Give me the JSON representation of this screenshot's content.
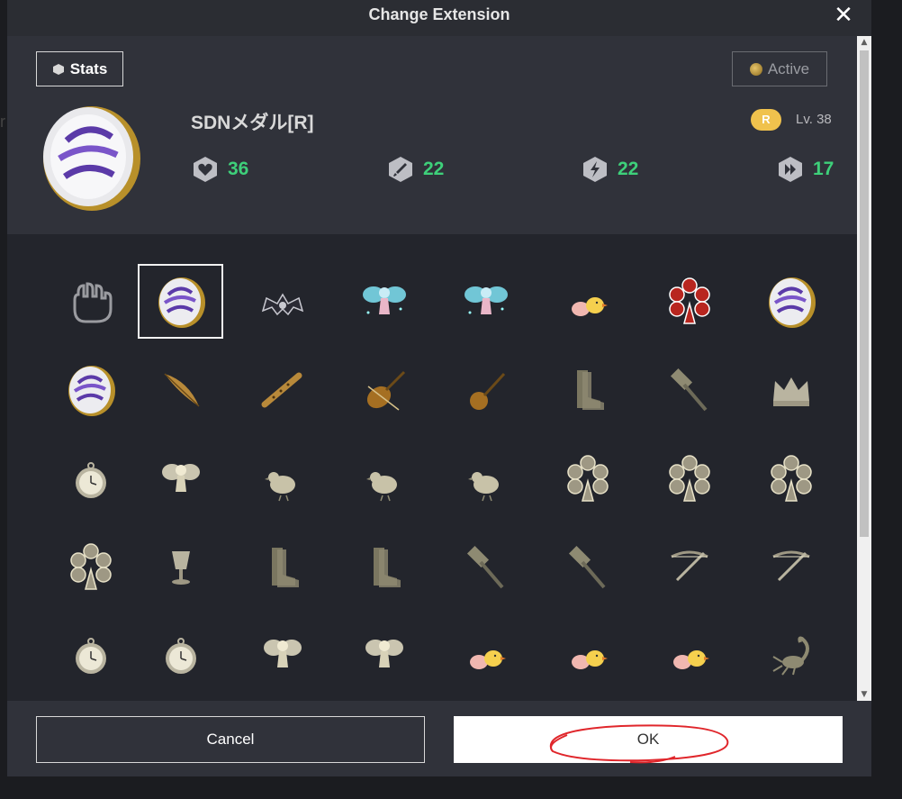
{
  "dialog": {
    "title": "Change Extension",
    "close_icon": "close-icon"
  },
  "stats_panel": {
    "stats_label": "Stats",
    "active_label": "Active",
    "item_name": "SDNメダル[R]",
    "rarity": "R",
    "level": "Lv. 38",
    "stats": [
      {
        "icon": "heart-icon",
        "value": "36"
      },
      {
        "icon": "sword-icon",
        "value": "22"
      },
      {
        "icon": "lightning-icon",
        "value": "22"
      },
      {
        "icon": "speed-icon",
        "value": "17"
      }
    ]
  },
  "items": [
    {
      "icon": "empty-hand-icon",
      "selected": false
    },
    {
      "icon": "sdn-medal-icon",
      "selected": true
    },
    {
      "icon": "bat-wings-icon",
      "selected": false
    },
    {
      "icon": "blue-fairy-icon",
      "selected": false
    },
    {
      "icon": "blue-fairy-icon",
      "selected": false
    },
    {
      "icon": "chicks-icon",
      "selected": false
    },
    {
      "icon": "red-ferris-wheel-icon",
      "selected": false
    },
    {
      "icon": "sdn-medal-icon",
      "selected": false
    },
    {
      "icon": "sdn-medal-icon",
      "selected": false
    },
    {
      "icon": "feather-quill-icon",
      "selected": false
    },
    {
      "icon": "flute-icon",
      "selected": false
    },
    {
      "icon": "violin-icon",
      "selected": false
    },
    {
      "icon": "sitar-icon",
      "selected": false
    },
    {
      "icon": "boots-icon",
      "selected": false
    },
    {
      "icon": "hammer-icon",
      "selected": false
    },
    {
      "icon": "crown-icon",
      "selected": false
    },
    {
      "icon": "pocket-watch-icon",
      "selected": false
    },
    {
      "icon": "fairy-icon",
      "selected": false
    },
    {
      "icon": "bird-icon",
      "selected": false
    },
    {
      "icon": "bird-icon",
      "selected": false
    },
    {
      "icon": "bird-icon",
      "selected": false
    },
    {
      "icon": "ferris-wheel-icon",
      "selected": false
    },
    {
      "icon": "ferris-wheel-icon",
      "selected": false
    },
    {
      "icon": "ferris-wheel-icon",
      "selected": false
    },
    {
      "icon": "ferris-wheel-icon",
      "selected": false
    },
    {
      "icon": "goblet-icon",
      "selected": false
    },
    {
      "icon": "boots-icon",
      "selected": false
    },
    {
      "icon": "boots-icon",
      "selected": false
    },
    {
      "icon": "hammer-icon",
      "selected": false
    },
    {
      "icon": "hammer-icon",
      "selected": false
    },
    {
      "icon": "crossbow-icon",
      "selected": false
    },
    {
      "icon": "crossbow-icon",
      "selected": false
    },
    {
      "icon": "pocket-watch-icon",
      "selected": false
    },
    {
      "icon": "pocket-watch-icon",
      "selected": false
    },
    {
      "icon": "fairy-icon",
      "selected": false
    },
    {
      "icon": "fairy-icon",
      "selected": false
    },
    {
      "icon": "chicks-icon",
      "selected": false
    },
    {
      "icon": "chicks-icon",
      "selected": false
    },
    {
      "icon": "chicks-icon",
      "selected": false
    },
    {
      "icon": "scorpion-icon",
      "selected": false
    }
  ],
  "footer": {
    "cancel_label": "Cancel",
    "ok_label": "OK"
  },
  "colors": {
    "stat_value": "#3ed07a",
    "rarity_badge": "#f0c24d",
    "annotation_circle": "#e0262b"
  }
}
